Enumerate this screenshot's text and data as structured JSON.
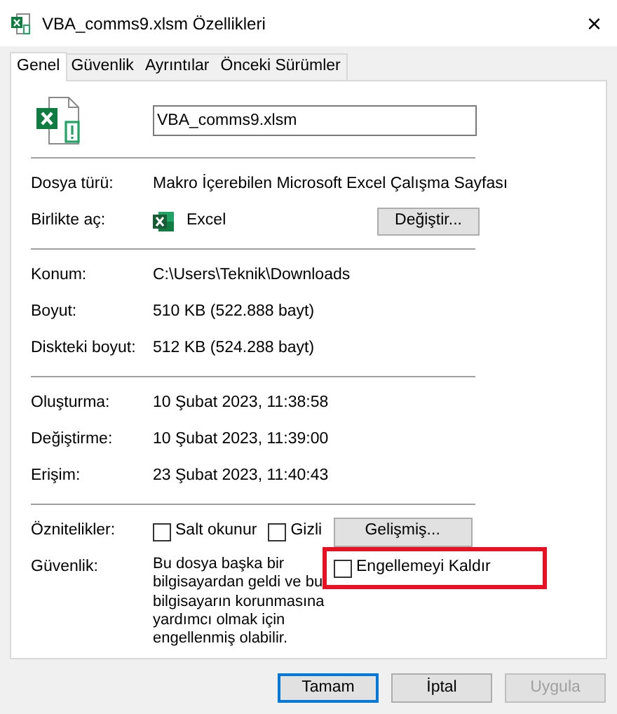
{
  "window": {
    "title": "VBA_comms9.xlsm Özellikleri",
    "close": "×"
  },
  "tabs": [
    {
      "label": "Genel",
      "selected": true
    },
    {
      "label": "Güvenlik",
      "selected": false
    },
    {
      "label": "Ayrıntılar",
      "selected": false
    },
    {
      "label": "Önceki Sürümler",
      "selected": false
    }
  ],
  "file_name": "VBA_comms9.xlsm",
  "file_type": {
    "label": "Dosya türü:",
    "value": "Makro İçerebilen Microsoft Excel Çalışma Sayfası"
  },
  "opens_with": {
    "label": "Birlikte aç:",
    "app": "Excel",
    "button": "Değiştir..."
  },
  "location_rows": [
    {
      "label": "Konum:",
      "value": "C:\\Users\\Teknik\\Downloads"
    },
    {
      "label": "Boyut:",
      "value": "510 KB (522.888 bayt)"
    },
    {
      "label": "Diskteki boyut:",
      "value": "512 KB (524.288 bayt)"
    }
  ],
  "date_rows": [
    {
      "label": "Oluşturma:",
      "value": "10 Şubat 2023, 11:38:58"
    },
    {
      "label": "Değiştirme:",
      "value": "10 Şubat 2023, 11:39:00"
    },
    {
      "label": "Erişim:",
      "value": "23 Şubat 2023, 11:40:43"
    }
  ],
  "attributes": {
    "label": "Öznitelikler:",
    "options": [
      {
        "label": "Salt okunur",
        "checked": false
      },
      {
        "label": "Gizli",
        "checked": false
      }
    ],
    "button": "Gelişmiş..."
  },
  "security": {
    "label": "Güvenlik:",
    "text": "Bu dosya başka bir bilgisayardan geldi ve bu bilgisayarın korunmasına yardımcı olmak için engellenmiş olabilir.",
    "unblock": {
      "label": "Engellemeyi Kaldır",
      "checked": false,
      "highlighted": true
    }
  },
  "buttons": [
    {
      "label": "Tamam",
      "default": true,
      "disabled": false
    },
    {
      "label": "İptal",
      "default": false,
      "disabled": false
    },
    {
      "label": "Uygula",
      "default": false,
      "disabled": true
    }
  ]
}
